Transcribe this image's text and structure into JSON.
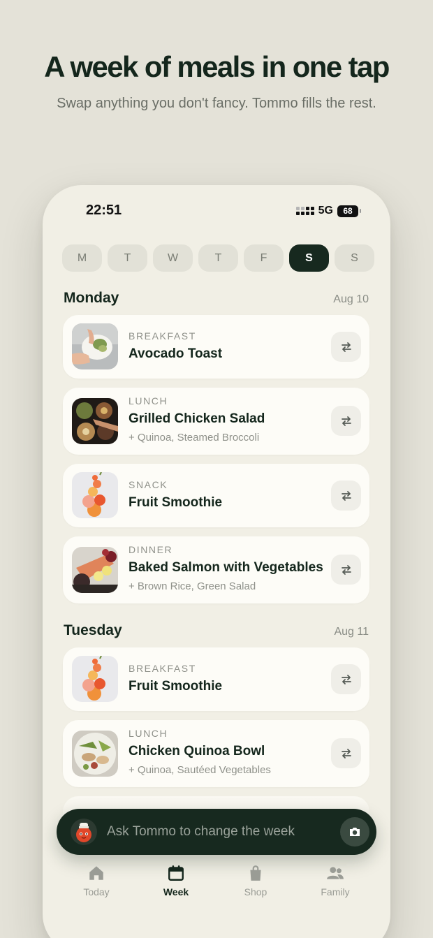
{
  "header": {
    "title": "A week of meals in one tap",
    "subtitle": "Swap anything you don't fancy. Tommo fills the rest."
  },
  "status_bar": {
    "time": "22:51",
    "network": "5G",
    "battery": "68"
  },
  "week_days": [
    {
      "label": "M",
      "active": false
    },
    {
      "label": "T",
      "active": false
    },
    {
      "label": "W",
      "active": false
    },
    {
      "label": "T",
      "active": false
    },
    {
      "label": "F",
      "active": false
    },
    {
      "label": "S",
      "active": true
    },
    {
      "label": "S",
      "active": false
    }
  ],
  "days": [
    {
      "name": "Monday",
      "date": "Aug 10",
      "meals": [
        {
          "type": "BREAKFAST",
          "name": "Avocado Toast",
          "sides": "",
          "image": "avocado-toast-photo"
        },
        {
          "type": "LUNCH",
          "name": "Grilled Chicken Salad",
          "sides": "+ Quinoa, Steamed Broccoli",
          "image": "chicken-salad-photo"
        },
        {
          "type": "SNACK",
          "name": "Fruit Smoothie",
          "sides": "",
          "image": "fruit-stack-photo"
        },
        {
          "type": "DINNER",
          "name": "Baked Salmon with Vegetables",
          "sides": "+ Brown Rice, Green Salad",
          "image": "salmon-photo"
        }
      ]
    },
    {
      "name": "Tuesday",
      "date": "Aug 11",
      "meals": [
        {
          "type": "BREAKFAST",
          "name": "Fruit Smoothie",
          "sides": "",
          "image": "fruit-stack-photo"
        },
        {
          "type": "LUNCH",
          "name": "Chicken Quinoa Bowl",
          "sides": "+ Quinoa, Sautéed Vegetables",
          "image": "quinoa-bowl-photo"
        }
      ]
    }
  ],
  "ask_bar": {
    "placeholder": "Ask Tommo to change the week"
  },
  "tabs": [
    {
      "label": "Today",
      "icon": "home-icon",
      "active": false
    },
    {
      "label": "Week",
      "icon": "calendar-icon",
      "active": true
    },
    {
      "label": "Shop",
      "icon": "shopping-bag-icon",
      "active": false
    },
    {
      "label": "Family",
      "icon": "people-icon",
      "active": false
    }
  ],
  "colors": {
    "background": "#e4e2d8",
    "phone": "#f1efe5",
    "accent_dark": "#17291f",
    "card": "#fdfcf7",
    "muted_text": "#8f918a"
  }
}
